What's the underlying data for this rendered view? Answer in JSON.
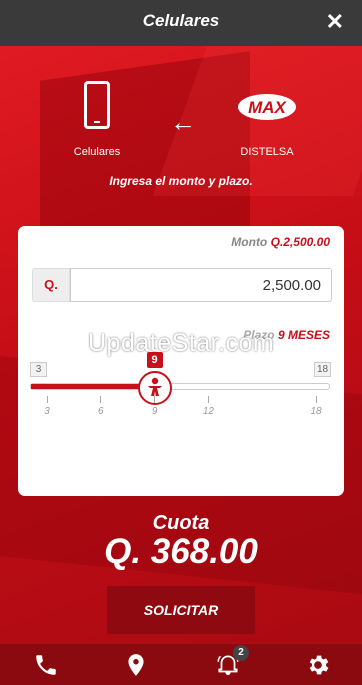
{
  "header": {
    "title": "Celulares",
    "close_icon": "close-icon",
    "close_glyph": "✕"
  },
  "hero": {
    "left_label": "Celulares",
    "right_label": "DISTELSA",
    "arrow_glyph": "←",
    "logo_text": "MAX",
    "instructions": "Ingresa el monto y plazo."
  },
  "form": {
    "monto_label": "Monto",
    "monto_value": "Q.2,500.00",
    "currency_label": "Q.",
    "amount_value": "2,500.00",
    "plazo_label": "Plazo",
    "plazo_value": "9 MESES",
    "slider": {
      "min_label": "3",
      "max_label": "18",
      "current_label": "9",
      "min": 3,
      "max": 18,
      "value": 9,
      "ticks": [
        {
          "value": 3,
          "label": "3"
        },
        {
          "value": 6,
          "label": "6"
        },
        {
          "value": 9,
          "label": "9"
        },
        {
          "value": 12,
          "label": "12"
        },
        {
          "value": 18,
          "label": "18"
        }
      ]
    }
  },
  "result": {
    "cuota_label": "Cuota",
    "cuota_value": "Q. 368.00"
  },
  "action": {
    "solicitar_label": "SOLICITAR"
  },
  "bottom_nav": {
    "items": [
      {
        "icon": "phone-icon"
      },
      {
        "icon": "location-pin-icon"
      },
      {
        "icon": "alarm-bell-icon"
      },
      {
        "icon": "gear-icon"
      }
    ],
    "badge": "2"
  },
  "watermark": "UpdateStar.com",
  "colors": {
    "brand_red": "#c8101a",
    "dark_red": "#8e0a10",
    "topbar": "#3a3a3a"
  }
}
